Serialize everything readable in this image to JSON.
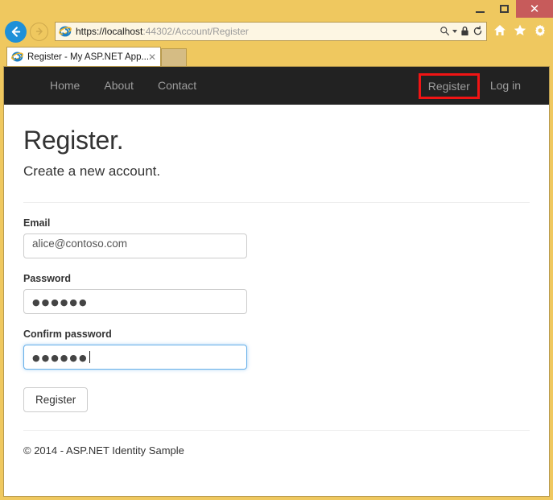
{
  "browser": {
    "window_controls": {
      "minimize_label": "–",
      "maximize_label": "□",
      "close_label": "✕"
    },
    "back_icon": "←",
    "forward_icon": "→",
    "favicon_name": "internet-explorer-icon",
    "url": {
      "full": "https://localhost:44302/Account/Register",
      "scheme": "https://",
      "host": "localhost",
      "port": ":44302",
      "path": "/Account/Register"
    },
    "address_icons": {
      "search": "⚲",
      "lock": "ὑ2",
      "refresh": "↻"
    },
    "toolbar_icons": {
      "home": "⌂",
      "favorites": "★",
      "settings": "⚙"
    },
    "tab": {
      "title": "Register - My ASP.NET App...",
      "close_label": "✕"
    }
  },
  "site": {
    "nav": {
      "left_items": [
        {
          "label": "Home"
        },
        {
          "label": "About"
        },
        {
          "label": "Contact"
        }
      ],
      "right_items": [
        {
          "label": "Register",
          "highlighted": true
        },
        {
          "label": "Log in",
          "highlighted": false
        }
      ]
    },
    "page": {
      "title": "Register.",
      "subtitle": "Create a new account.",
      "fields": [
        {
          "label": "Email",
          "value": "alice@contoso.com",
          "type": "email",
          "focused": false
        },
        {
          "label": "Password",
          "value": "●●●●●●",
          "type": "password",
          "focused": false
        },
        {
          "label": "Confirm password",
          "value": "●●●●●●",
          "type": "password",
          "focused": true
        }
      ],
      "submit_label": "Register",
      "footer": "© 2014 - ASP.NET Identity Sample"
    }
  },
  "colors": {
    "chrome": "#efc85f",
    "navbar": "#222222",
    "highlight_red": "#f01414",
    "focus_blue": "#66afe9",
    "close_button": "#c75b5b",
    "back_button": "#1e90d8"
  }
}
